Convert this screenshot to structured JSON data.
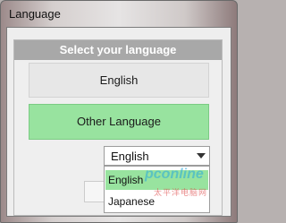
{
  "window": {
    "title": "Language"
  },
  "panel": {
    "header": "Select your language"
  },
  "buttons": {
    "english": "English",
    "other": "Other Language"
  },
  "language_select": {
    "value": "English",
    "options": [
      "English",
      "Japanese"
    ],
    "highlighted_index": 0
  },
  "watermark": {
    "main": "pconline",
    "sub": "太平洋电脑网"
  },
  "colors": {
    "accent": "#98e39f",
    "header_bg": "#a8a8a8"
  }
}
